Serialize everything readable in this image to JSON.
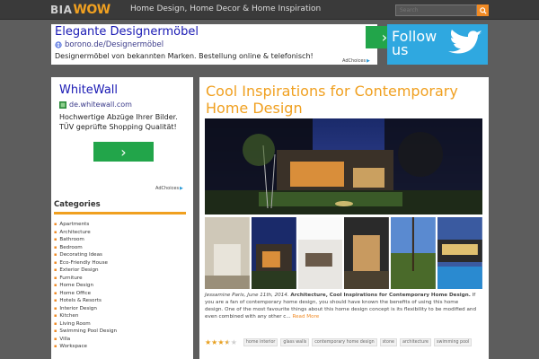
{
  "header": {
    "logo_bia": "BIA",
    "logo_wow": "WOW",
    "tagline": "Home Design, Home Decor & Home Inspiration",
    "search_placeholder": "Search"
  },
  "ad_top": {
    "headline": "Elegante Designermöbel",
    "url": "borono.de/Designermöbel",
    "description": "Designermöbel von bekannten Marken. Bestellung online & telefonisch!",
    "adchoices": "AdChoices"
  },
  "follow": {
    "line1": "Follow",
    "line2": "us"
  },
  "sidebar": {
    "ad": {
      "headline": "WhiteWall",
      "url": "de.whitewall.com",
      "description": "Hochwertige Abzüge Ihrer Bilder. TÜV geprüfte Shopping Qualität!",
      "adchoices": "AdChoices"
    },
    "categories_title": "Categories",
    "categories": [
      "Apartments",
      "Architecture",
      "Bathroom",
      "Bedroom",
      "Decorating Ideas",
      "Eco-Friendly House",
      "Exterior Design",
      "Furniture",
      "Home Design",
      "Home Office",
      "Hotels & Resorts",
      "Interior Design",
      "Kitchen",
      "Living Room",
      "Swimming Pool Design",
      "Villa",
      "Workspace"
    ]
  },
  "article": {
    "title": "Cool Inspirations for Contemporary Home Design",
    "date": "Jessamine Paris, June 11th, 2014.",
    "lead": "Architecture, Cool Inspirations for Contemporary Home Design.",
    "body": " If you are a fan of contemporary home design, you should have known the benefits of using this home design. One of the most favourite things about this home design concept is its flexibility to be modified and even combined with any other c...",
    "read_more": "Read More",
    "rating": 3.5,
    "rating_max": 5,
    "tags": [
      "home interior",
      "glass walls",
      "contemporary home design",
      "stone",
      "architecture",
      "swimming pool"
    ]
  },
  "colors": {
    "accent": "#f0a020",
    "ad_link": "#1a1ab4",
    "ad_button": "#22a54a",
    "twitter": "#2fa8e0"
  }
}
